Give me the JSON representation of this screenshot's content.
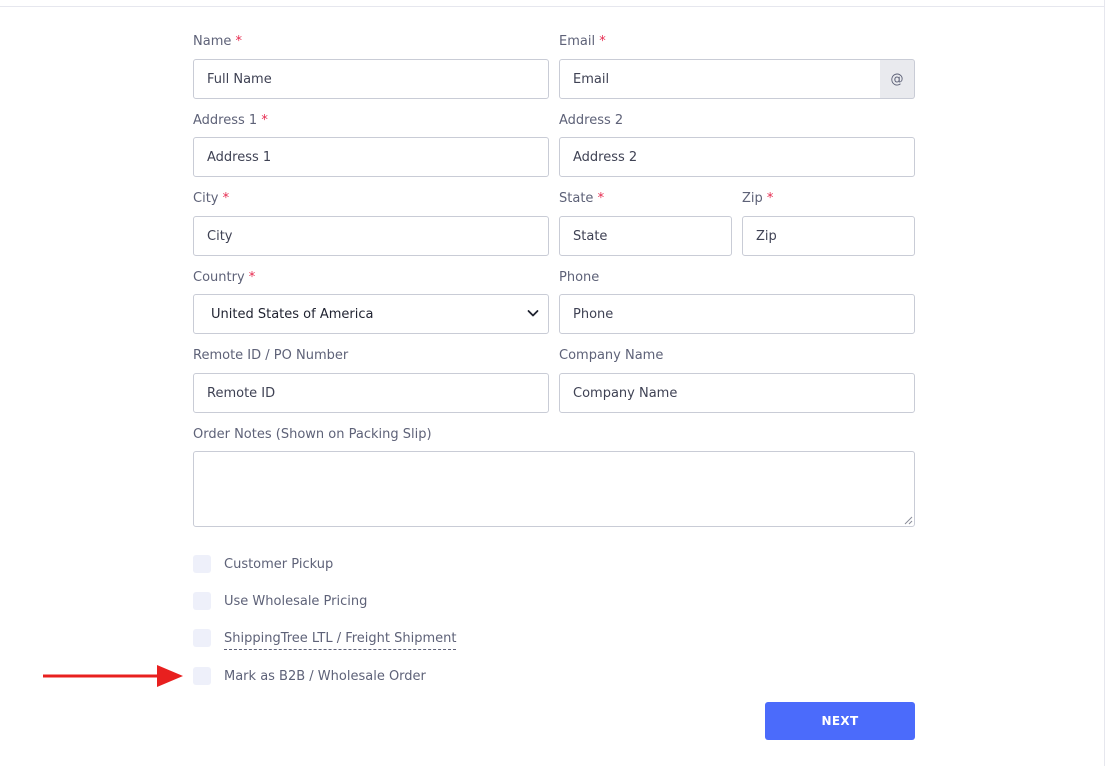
{
  "form": {
    "name": {
      "label": "Name",
      "required": "*",
      "placeholder": "Full Name"
    },
    "email": {
      "label": "Email",
      "required": "*",
      "placeholder": "Email",
      "addon": "@"
    },
    "address1": {
      "label": "Address 1",
      "required": "*",
      "placeholder": "Address 1"
    },
    "address2": {
      "label": "Address 2",
      "placeholder": "Address 2"
    },
    "city": {
      "label": "City",
      "required": "*",
      "placeholder": "City"
    },
    "state": {
      "label": "State",
      "required": "*",
      "placeholder": "State"
    },
    "zip": {
      "label": "Zip",
      "required": "*",
      "placeholder": "Zip"
    },
    "country": {
      "label": "Country",
      "required": "*",
      "value": "United States of America"
    },
    "phone": {
      "label": "Phone",
      "placeholder": "Phone"
    },
    "remote_id": {
      "label": "Remote ID / PO Number",
      "placeholder": "Remote ID"
    },
    "company": {
      "label": "Company Name",
      "placeholder": "Company Name"
    },
    "notes": {
      "label": "Order Notes (Shown on Packing Slip)"
    }
  },
  "checkboxes": [
    {
      "label": "Customer Pickup"
    },
    {
      "label": "Use Wholesale Pricing"
    },
    {
      "label": "ShippingTree LTL / Freight Shipment"
    },
    {
      "label": "Mark as B2B / Wholesale Order"
    }
  ],
  "actions": {
    "next_label": "NEXT"
  },
  "colors": {
    "primary": "#4b6bfb",
    "required": "#e6294e",
    "annotation_arrow": "#e8201f",
    "checkbox_bg": "#eef0fa"
  },
  "icons": [
    "chevron-down-icon",
    "resize-grip-icon",
    "red-arrow-annotation"
  ]
}
